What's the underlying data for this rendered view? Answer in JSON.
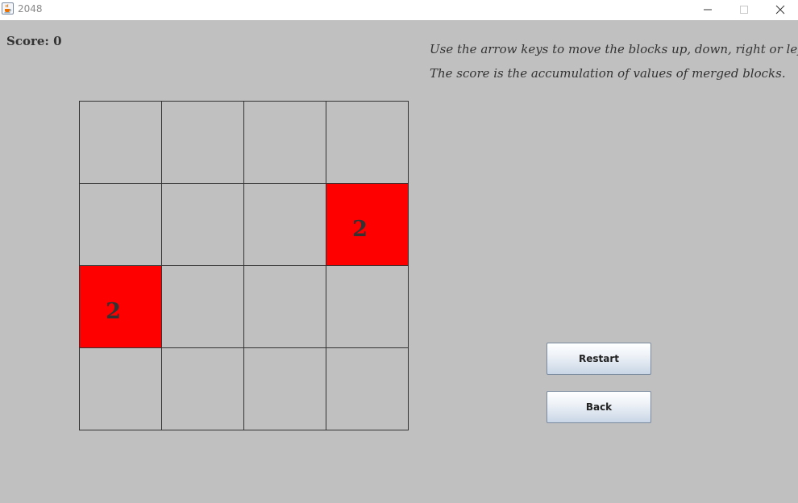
{
  "window": {
    "title": "2048",
    "icon": "java-cup-icon",
    "controls": [
      "minimize-icon",
      "maximize-icon",
      "close-icon"
    ]
  },
  "score": {
    "label": "Score: 0",
    "value": 0
  },
  "instructions": {
    "line1": "Use the arrow keys to move the blocks up, down, right or left.",
    "line2": "The score is the accumulation of values of merged blocks."
  },
  "board": {
    "size": 4,
    "rows": [
      [
        "",
        "",
        "",
        ""
      ],
      [
        "",
        "",
        "",
        "2"
      ],
      [
        "2",
        "",
        "",
        ""
      ],
      [
        "",
        "",
        "",
        ""
      ]
    ],
    "tile_color": "#ff0000",
    "background": "#c0c0c0"
  },
  "buttons": {
    "restart_label": "Restart",
    "back_label": "Back"
  }
}
